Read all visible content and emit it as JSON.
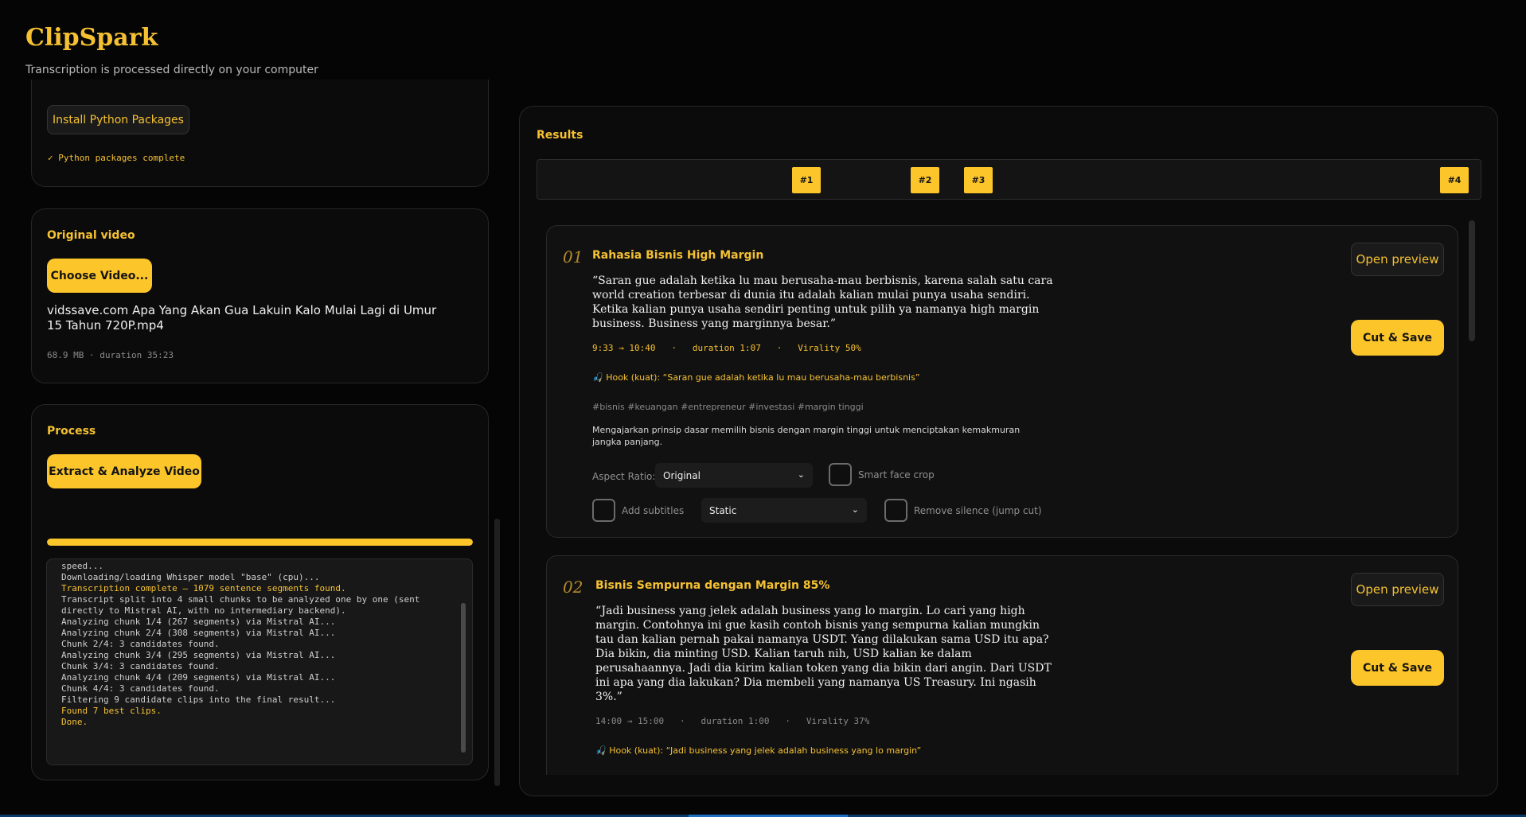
{
  "app": {
    "title": "ClipSpark",
    "subtitle": "Transcription is processed directly on your computer"
  },
  "setup": {
    "install_button": "Install Python Packages",
    "status": "✓ Python packages complete"
  },
  "video": {
    "section_title": "Original video",
    "choose_button": "Choose Video...",
    "filename": "vidssave.com Apa Yang Akan Gua Lakuin Kalo Mulai Lagi di Umur 15 Tahun 720P.mp4",
    "meta": "68.9 MB · duration 35:23"
  },
  "process": {
    "section_title": "Process",
    "extract_button": "Extract & Analyze Video",
    "progress": 1.0,
    "log": [
      {
        "text": "speed...",
        "highlight": false
      },
      {
        "text": "Downloading/loading Whisper model \"base\" (cpu)...",
        "highlight": false
      },
      {
        "text": "Transcription complete — 1079 sentence segments found.",
        "highlight": true
      },
      {
        "text": "Transcript split into 4 small chunks to be analyzed one by one (sent",
        "highlight": false
      },
      {
        "text": "directly to Mistral AI, with no intermediary backend).",
        "highlight": false
      },
      {
        "text": "Analyzing chunk 1/4 (267 segments) via Mistral AI...",
        "highlight": false
      },
      {
        "text": "Analyzing chunk 2/4 (308 segments) via Mistral AI...",
        "highlight": false
      },
      {
        "text": "Chunk 2/4: 3 candidates found.",
        "highlight": false
      },
      {
        "text": "Analyzing chunk 3/4 (295 segments) via Mistral AI...",
        "highlight": false
      },
      {
        "text": "Chunk 3/4: 3 candidates found.",
        "highlight": false
      },
      {
        "text": "Analyzing chunk 4/4 (209 segments) via Mistral AI...",
        "highlight": false
      },
      {
        "text": "Chunk 4/4: 3 candidates found.",
        "highlight": false
      },
      {
        "text": "Filtering 9 candidate clips into the final result...",
        "highlight": false
      },
      {
        "text": "Found 7 best clips.",
        "highlight": true
      },
      {
        "text": "Done.",
        "highlight": true
      }
    ]
  },
  "results": {
    "section_title": "Results",
    "markers": [
      "#1",
      "#2",
      "#3",
      "#4"
    ],
    "clips": [
      {
        "number": "01",
        "title": "Rahasia Bisnis High Margin",
        "quote": "“Saran gue adalah ketika lu mau berusaha-mau berbisnis, karena salah satu cara world creation terbesar di dunia itu adalah kalian mulai punya usaha sendiri. Ketika kalian punya usaha sendiri penting untuk pilih ya namanya high margin business. Business yang marginnya besar.”",
        "meta": "9:33 → 10:40   ·   duration 1:07   ·   Virality 50%",
        "hook": "🎣 Hook (kuat): “Saran gue adalah ketika lu mau berusaha-mau berbisnis”",
        "tags": "#bisnis  #keuangan  #entrepreneur  #investasi  #margin tinggi",
        "description": "Mengajarkan prinsip dasar memilih bisnis dengan margin tinggi untuk menciptakan kemakmuran jangka panjang.",
        "preview_button": "Open preview",
        "cut_button": "Cut & Save",
        "aspect_label": "Aspect Ratio:",
        "aspect_value": "Original",
        "face_crop_label": "Smart face crop",
        "subtitles_label": "Add subtitles",
        "subtitle_style": "Static",
        "silence_label": "Remove silence (jump cut)"
      },
      {
        "number": "02",
        "title": "Bisnis Sempurna dengan Margin 85%",
        "quote": "“Jadi business yang jelek adalah business yang lo margin. Lo cari yang high margin. Contohnya ini gue kasih contoh bisnis yang sempurna kalian mungkin tau dan kalian pernah pakai namanya USDT. Yang dilakukan sama USD itu apa? Dia bikin, dia minting USD. Kalian taruh nih, USD kalian ke dalam perusahaannya. Jadi dia kirim kalian token yang dia bikin dari angin. Dari USDT ini apa yang dia lakukan? Dia membeli yang namanya US Treasury. Ini ngasih 3%.”",
        "meta": "14:00 → 15:00   ·   duration 1:00   ·   Virality 37%",
        "hook": "🎣 Hook (kuat): “Jadi business yang jelek adalah business yang lo margin”",
        "preview_button": "Open preview",
        "cut_button": "Cut & Save"
      }
    ]
  }
}
